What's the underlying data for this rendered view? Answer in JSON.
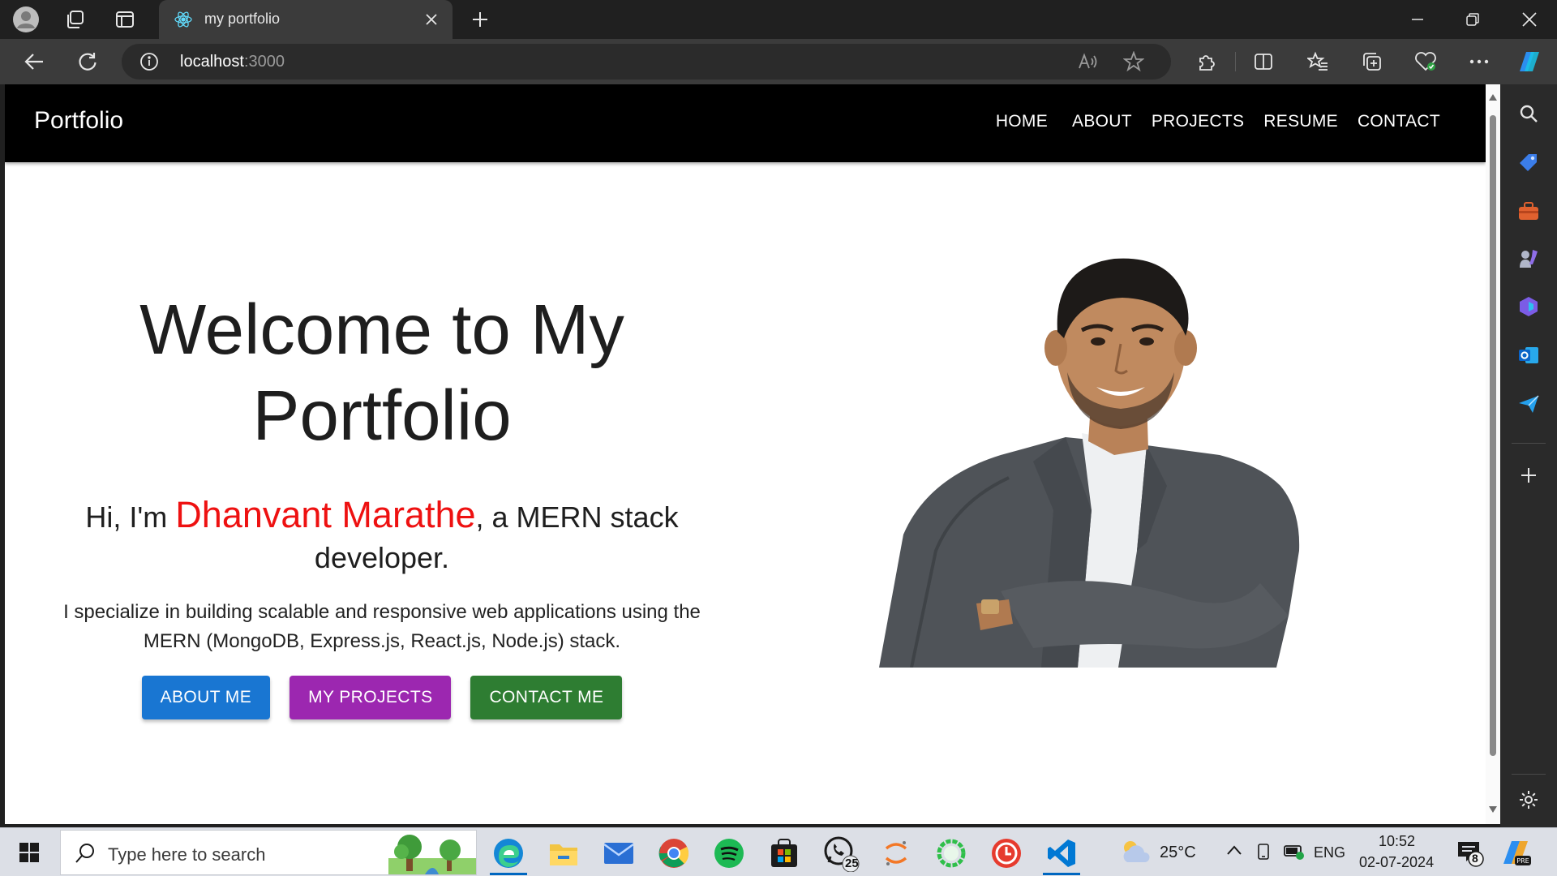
{
  "browser": {
    "tab_title": "my portfolio",
    "url_host": "localhost",
    "url_port": ":3000"
  },
  "app": {
    "brand": "Portfolio",
    "nav": [
      "HOME",
      "ABOUT",
      "PROJECTS",
      "RESUME",
      "CONTACT"
    ]
  },
  "hero": {
    "title_line1": "Welcome to My",
    "title_line2": "Portfolio",
    "sub_prefix": "Hi, I'm ",
    "name": "Dhanvant Marathe",
    "sub_suffix_line1": ", a MERN stack",
    "sub_suffix_line2": "developer.",
    "description": "I specialize in building scalable and responsive web applications using the MERN (MongoDB, Express.js, React.js, Node.js) stack.",
    "buttons": [
      {
        "label": "ABOUT ME",
        "color": "#1976d2"
      },
      {
        "label": "MY PROJECTS",
        "color": "#9c27b0"
      },
      {
        "label": "CONTACT ME",
        "color": "#2e7d32"
      }
    ]
  },
  "taskbar": {
    "search_placeholder": "Type here to search",
    "whatsapp_badge": "25",
    "weather": "25°C",
    "language": "ENG",
    "time": "10:52",
    "date": "02-07-2024",
    "notifications": "8"
  }
}
